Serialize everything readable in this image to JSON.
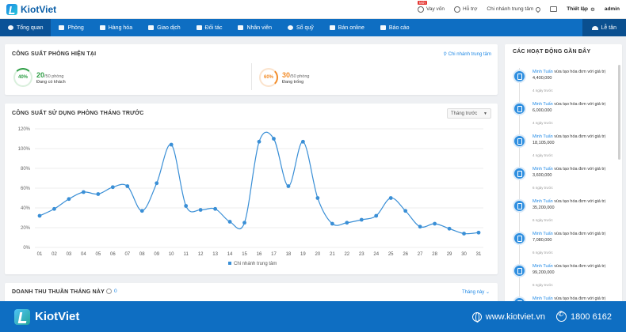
{
  "header": {
    "logo": "KiotViet",
    "vay_von": "Vay vốn",
    "new_badge": "Mới",
    "ho_tro": "Hỗ trợ",
    "branch": "Chi nhánh trung tâm",
    "thiet_lap": "Thiết lập",
    "user": "admin",
    "settings_icon": "gear-icon"
  },
  "nav": {
    "items": [
      {
        "label": "Tổng quan",
        "icon": "eye-icon"
      },
      {
        "label": "Phòng",
        "icon": "grid-icon"
      },
      {
        "label": "Hàng hóa",
        "icon": "box-icon"
      },
      {
        "label": "Giao dịch",
        "icon": "exchange-icon"
      },
      {
        "label": "Đối tác",
        "icon": "person-icon"
      },
      {
        "label": "Nhân viên",
        "icon": "people-icon"
      },
      {
        "label": "Sổ quỹ",
        "icon": "coin-icon"
      },
      {
        "label": "Bán online",
        "icon": "cart-icon"
      },
      {
        "label": "Báo cáo",
        "icon": "chart-icon"
      }
    ],
    "reception": "Lễ tân",
    "accent": "#0e6ec2",
    "active_bg": "#0a5297"
  },
  "capacity": {
    "title": "CÔNG SUẤT PHÒNG HIỆN TẠI",
    "branch_link": "Chi nhánh trung tâm",
    "occupied": {
      "pct": "40%",
      "count": "20",
      "total": "/50 phòng",
      "label": "Đang có khách",
      "color": "#2e9e45"
    },
    "empty": {
      "pct": "60%",
      "count": "30",
      "total": "/50 phòng",
      "label": "Đang trống",
      "color": "#f28c28"
    }
  },
  "usage": {
    "title": "CÔNG SUẤT SỬ DỤNG PHÒNG THÁNG TRƯỚC",
    "dropdown": "Tháng trước"
  },
  "chart_data": {
    "type": "line",
    "title": "CÔNG SUẤT SỬ DỤNG PHÒNG THÁNG TRƯỚC",
    "categories": [
      "01",
      "02",
      "03",
      "04",
      "05",
      "06",
      "07",
      "08",
      "09",
      "10",
      "11",
      "12",
      "13",
      "14",
      "15",
      "16",
      "17",
      "18",
      "19",
      "20",
      "21",
      "22",
      "23",
      "24",
      "25",
      "26",
      "27",
      "28",
      "29",
      "30",
      "31"
    ],
    "series": [
      {
        "name": "Chi nhánh trung tâm",
        "color": "#3a8fd6",
        "values": [
          32,
          39,
          49,
          56,
          54,
          61,
          62,
          37,
          65,
          104,
          42,
          38,
          39,
          26,
          25,
          107,
          110,
          62,
          107,
          50,
          24,
          25,
          28,
          32,
          50,
          37,
          21,
          24,
          19,
          14,
          15
        ]
      }
    ],
    "yticks": [
      "0%",
      "20%",
      "40%",
      "60%",
      "80%",
      "100%",
      "120%"
    ],
    "ylim": [
      0,
      120
    ],
    "grid": true,
    "legend": "bottom"
  },
  "revenue": {
    "title": "DOANH THU THUẦN THÁNG NÀY",
    "value": "0",
    "dropdown": "Tháng này"
  },
  "activities": {
    "title": "CÁC HOẠT ĐỘNG GẦN ĐÂY",
    "items": [
      {
        "user": "Minh Tuấn",
        "action": "vừa tạo hóa đơn với giá trị",
        "amount": "4,400,000",
        "time": "4 ngày trước"
      },
      {
        "user": "Minh Tuấn",
        "action": "vừa tạo hóa đơn với giá trị",
        "amount": "6,000,000",
        "time": "4 ngày trước"
      },
      {
        "user": "Minh Tuấn",
        "action": "vừa tạo hóa đơn với giá trị",
        "amount": "18,105,000",
        "time": "4 ngày trước"
      },
      {
        "user": "Minh Tuấn",
        "action": "vừa tạo hóa đơn với giá trị",
        "amount": "3,600,000",
        "time": "6 ngày trước"
      },
      {
        "user": "Minh Tuấn",
        "action": "vừa tạo hóa đơn với giá trị",
        "amount": "35,200,000",
        "time": "6 ngày trước"
      },
      {
        "user": "Minh Tuấn",
        "action": "vừa tạo hóa đơn với giá trị",
        "amount": "7,080,000",
        "time": "6 ngày trước"
      },
      {
        "user": "Minh Tuấn",
        "action": "vừa tạo hóa đơn với giá trị",
        "amount": "99,200,000",
        "time": "6 ngày trước"
      },
      {
        "user": "Minh Tuấn",
        "action": "vừa tạo hóa đơn với giá trị",
        "amount": "",
        "time": ""
      }
    ]
  },
  "footer": {
    "brand": "KiotViet",
    "website": "www.kiotviet.vn",
    "phone": "1800 6162"
  }
}
